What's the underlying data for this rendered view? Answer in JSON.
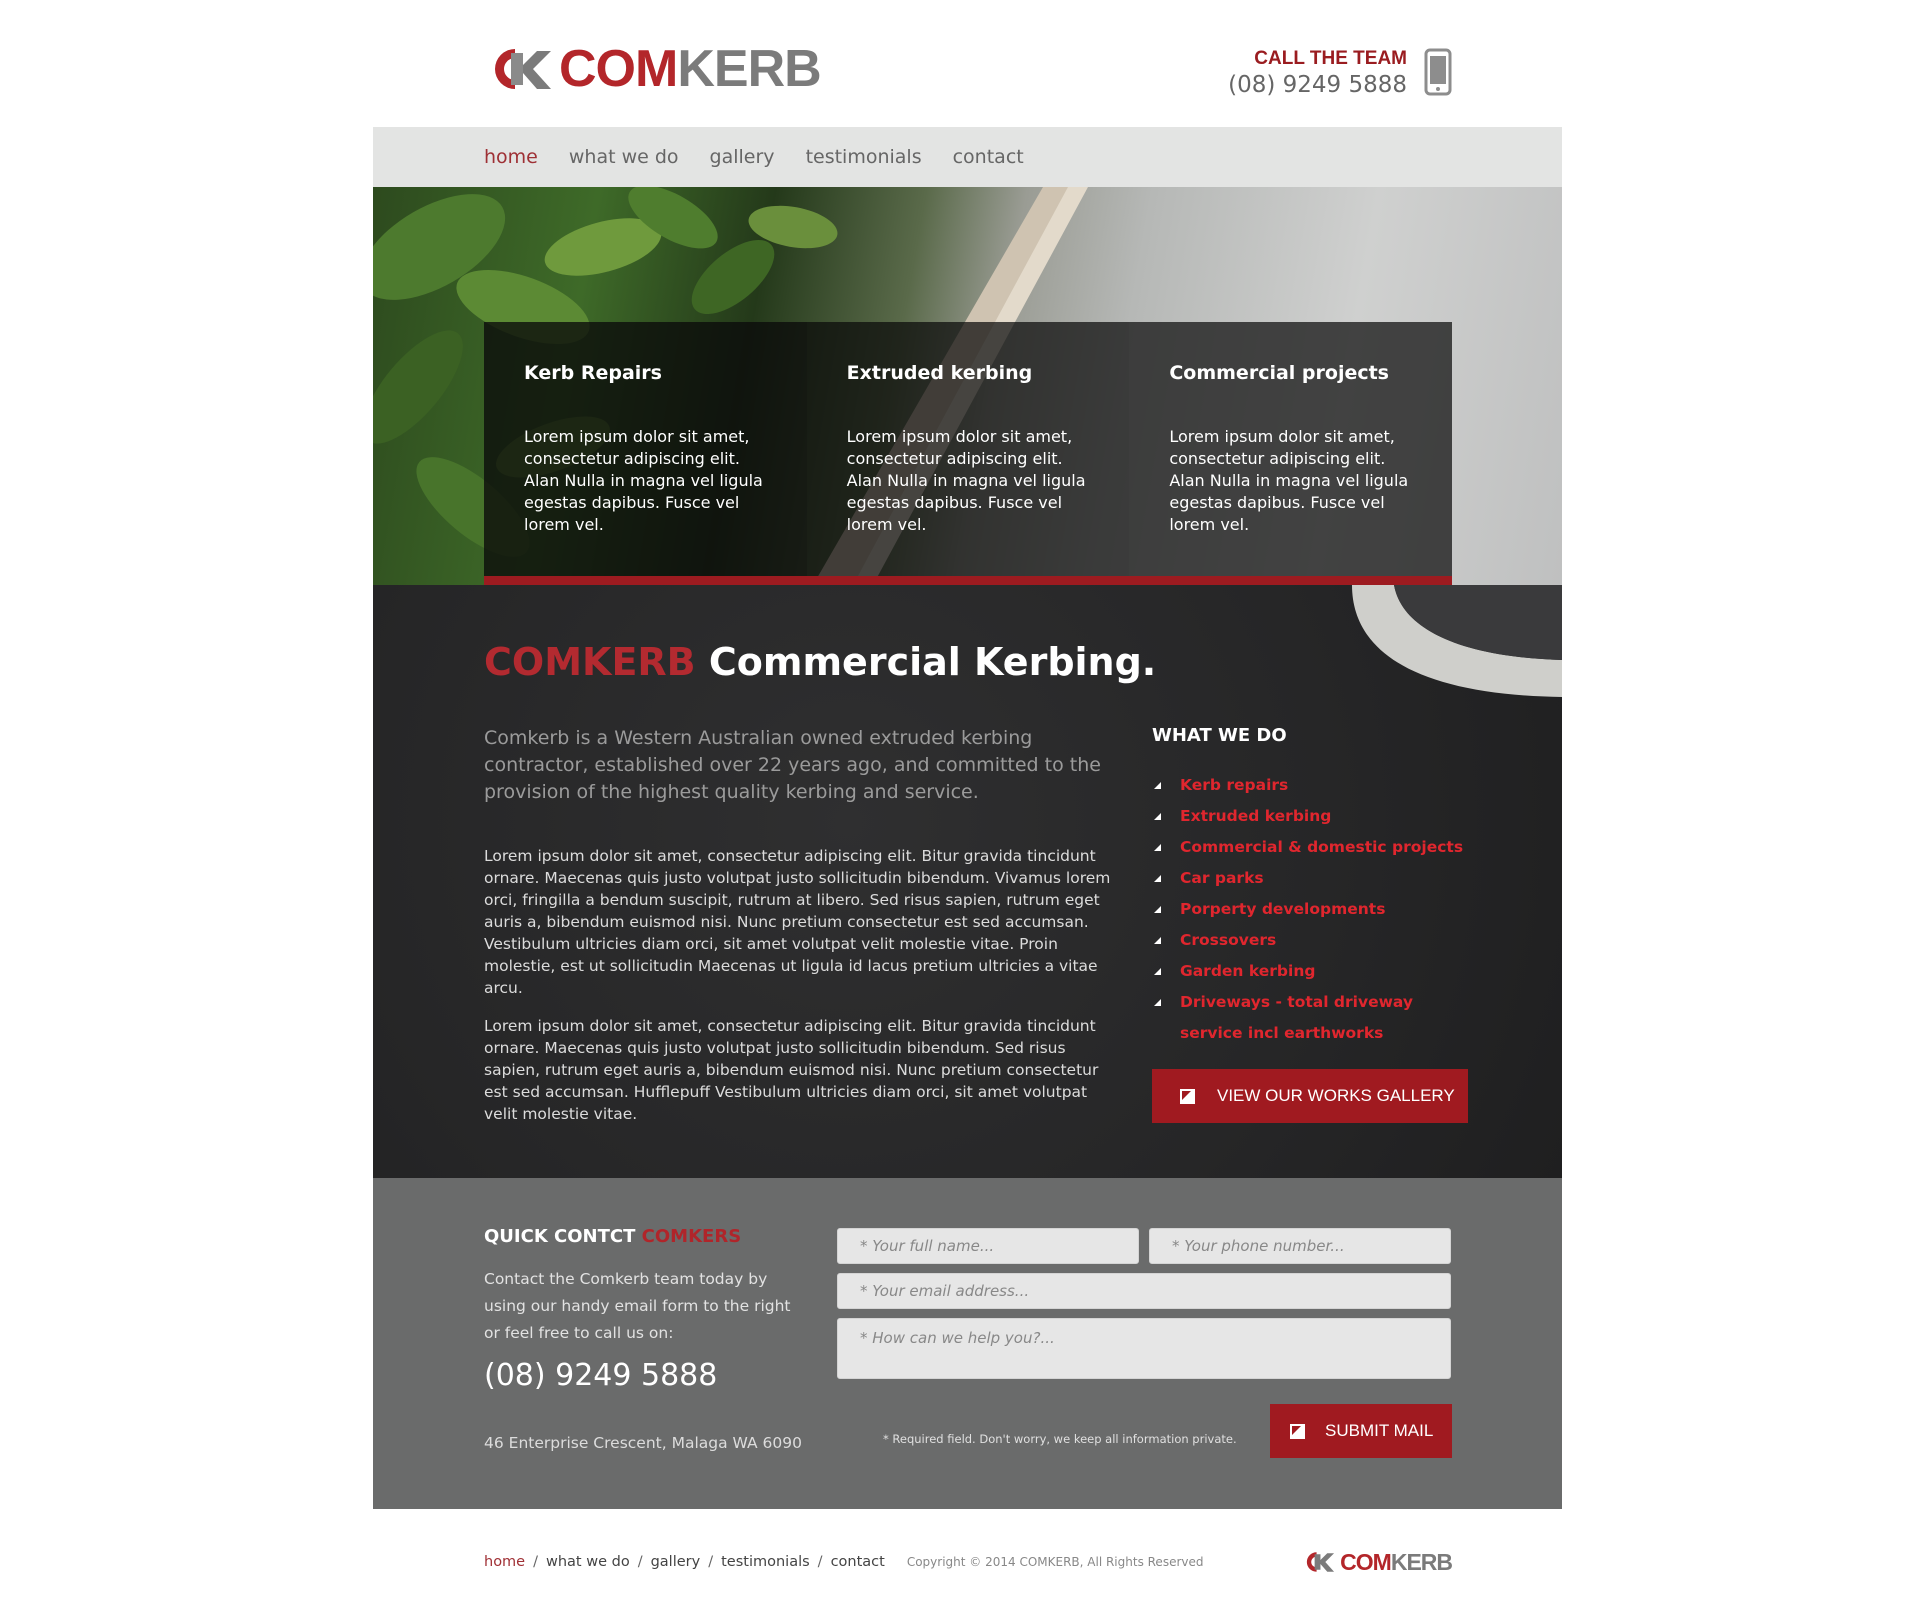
{
  "brand": {
    "logo_primary": "COM",
    "logo_secondary": "KERB",
    "accent_color": "#a01a20",
    "grey_color": "#7b7b7b"
  },
  "header": {
    "call_label": "CALL THE TEAM",
    "phone": "(08) 9249 5888",
    "phone_icon": "mobile-phone-icon"
  },
  "nav": {
    "items": [
      {
        "label": "home",
        "active": true
      },
      {
        "label": "what we do",
        "active": false
      },
      {
        "label": "gallery",
        "active": false
      },
      {
        "label": "testimonials",
        "active": false
      },
      {
        "label": "contact",
        "active": false
      }
    ]
  },
  "hero": {
    "boxes": [
      {
        "title": "Kerb Repairs",
        "text": "Lorem ipsum dolor sit amet, consectetur adipiscing elit. Alan Nulla in magna vel ligula egestas dapibus. Fusce vel lorem vel."
      },
      {
        "title": "Extruded kerbing",
        "text": "Lorem ipsum dolor sit amet, consectetur adipiscing elit. Alan Nulla in magna vel ligula egestas dapibus. Fusce vel lorem vel."
      },
      {
        "title": "Commercial projects",
        "text": "Lorem ipsum dolor sit amet, consectetur adipiscing elit. Alan Nulla in magna vel ligula egestas dapibus. Fusce vel lorem vel."
      }
    ]
  },
  "main": {
    "title_brand": "COMKERB",
    "title_rest": "Commercial Kerbing.",
    "lead": "Comkerb is a Western Australian owned extruded kerbing contractor, established over 22 years ago, and committed to the provision of the highest quality kerbing and service.",
    "para1": "Lorem ipsum dolor sit amet, consectetur adipiscing elit. Bitur gravida tincidunt ornare. Maecenas quis justo volutpat justo sollicitudin bibendum. Vivamus lorem orci, fringilla a bendum suscipit, rutrum at libero. Sed risus sapien, rutrum eget auris a, bibendum euismod nisi. Nunc pretium consectetur est sed accumsan. Vestibulum ultricies diam orci, sit amet volutpat velit molestie vitae. Proin molestie, est ut sollicitudin Maecenas ut ligula id lacus pretium ultricies a vitae arcu.",
    "para2": "Lorem ipsum dolor sit amet, consectetur adipiscing elit. Bitur gravida tincidunt ornare. Maecenas quis justo volutpat justo sollicitudin bibendum. Sed risus sapien, rutrum eget auris a, bibendum euismod nisi. Nunc pretium consectetur est sed accumsan. Hufflepuff Vestibulum ultricies diam orci, sit amet volutpat velit molestie vitae."
  },
  "what_we_do": {
    "title": "WHAT WE DO",
    "items": [
      "Kerb repairs",
      "Extruded kerbing",
      "Commercial & domestic projects",
      "Car parks",
      "Porperty developments",
      "Crossovers",
      "Garden kerbing",
      "Driveways - total driveway service incl earthworks"
    ],
    "button_label": "VIEW OUR WORKS GALLERY"
  },
  "quick_contact": {
    "title_main": "QUICK CONTCT",
    "title_brand": "COMKERS",
    "text": "Contact the Comkerb team today by using our handy email form to the right or feel free to call us on:",
    "phone": "(08) 9249 5888",
    "address": "46 Enterprise Crescent, Malaga WA 6090",
    "form": {
      "name_placeholder": "* Your full name...",
      "phone_placeholder": "* Your phone number...",
      "email_placeholder": "* Your email address...",
      "message_placeholder": "* How can we help you?...",
      "required_note": "* Required field. Don't worry, we keep all information private.",
      "submit_label": "SUBMIT MAIL"
    }
  },
  "footer": {
    "nav": [
      "home",
      "what we do",
      "gallery",
      "testimonials",
      "contact"
    ],
    "copyright": "Copyright © 2014 COMKERB, All Rights Reserved"
  }
}
